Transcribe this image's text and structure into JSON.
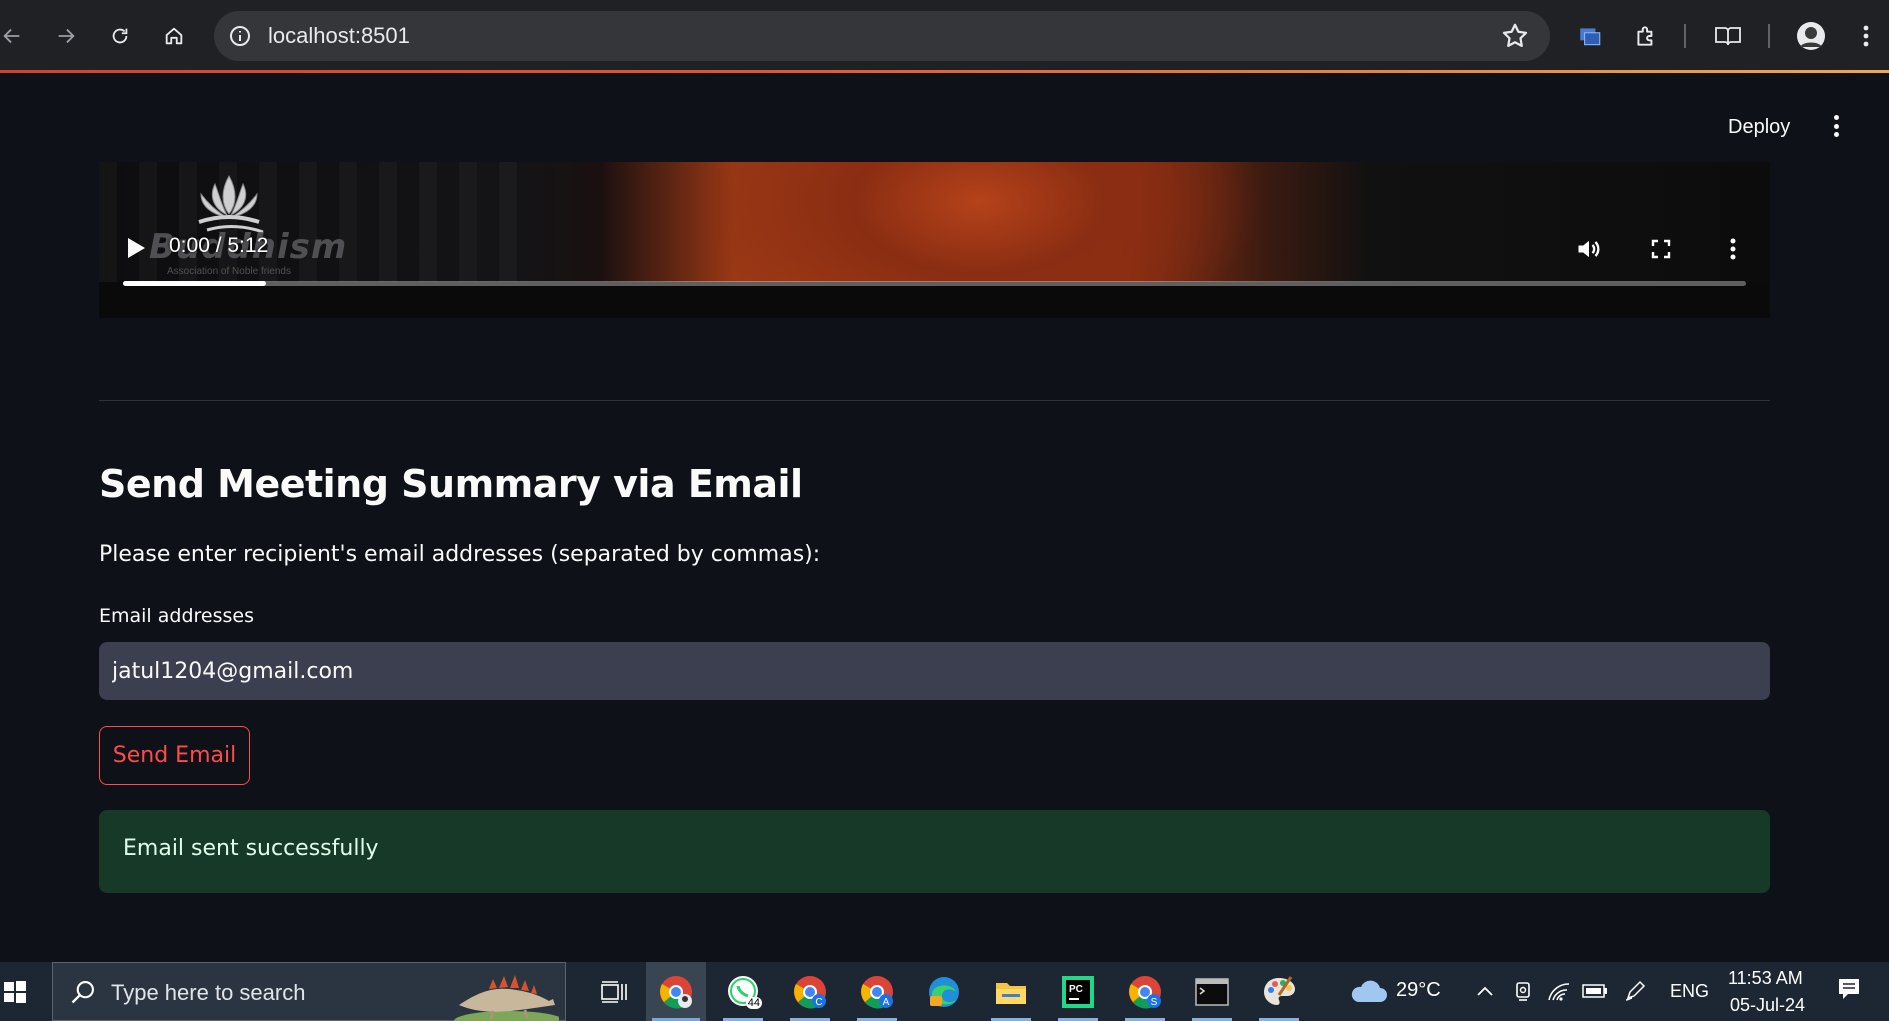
{
  "browser": {
    "url": "localhost:8501"
  },
  "app_header": {
    "deploy_label": "Deploy"
  },
  "video": {
    "time_display": "0:00 / 5:12",
    "logo_text": "Buddhism",
    "logo_subtext": "Association of Noble friends",
    "buffered_fraction": 0.088
  },
  "email_section": {
    "title": "Send Meeting Summary via Email",
    "instructions": "Please enter recipient's email addresses (separated by commas):",
    "field_label": "Email addresses",
    "field_value": "jatul1204@gmail.com",
    "send_button": "Send Email",
    "success_message": "Email sent successfully"
  },
  "taskbar": {
    "search_placeholder": "Type here to search",
    "whatsapp_badge": "44",
    "chrome_profiles": [
      "C",
      "A",
      "S"
    ],
    "weather": "29°C",
    "language": "ENG",
    "time": "11:53 AM",
    "date": "05-Jul-24"
  },
  "colors": {
    "app_background": "#0e1117",
    "primary_red": "#ff4b4b",
    "input_background": "#3b3f4f",
    "success_background": "#173928",
    "success_text": "#dffde9",
    "browser_toolbar": "#202124",
    "taskbar": "#1d2733"
  }
}
